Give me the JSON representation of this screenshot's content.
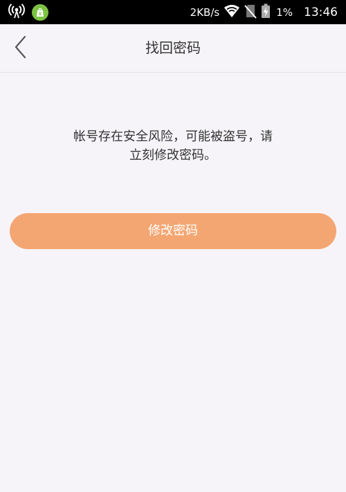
{
  "status_bar": {
    "left_icons": [
      "hotspot-icon",
      "app-store-icon"
    ],
    "net_speed": "2KB/s",
    "right_icons": [
      "wifi-icon",
      "no-sim-icon",
      "battery-charging-icon"
    ],
    "battery": "1%",
    "time": "13:46"
  },
  "nav": {
    "back_icon": "chevron-left-icon",
    "title": "找回密码"
  },
  "message": {
    "line1": "帐号存在安全风险，可能被盗号，请",
    "line2": "立刻修改密码。"
  },
  "action": {
    "label": "修改密码"
  },
  "colors": {
    "status_bar": "#000000",
    "background": "#f6f4f8",
    "button": "#f4a672",
    "button_text": "#ffffff",
    "text": "#333333",
    "app_badge": "#7dc242"
  }
}
